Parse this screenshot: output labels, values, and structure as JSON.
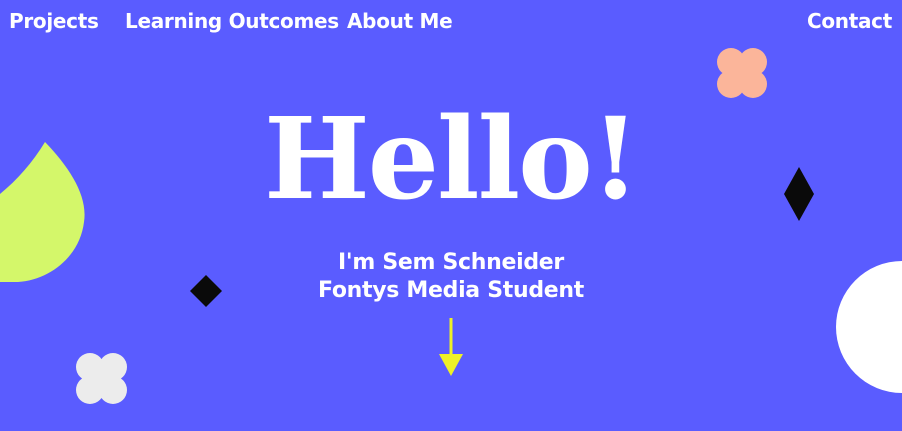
{
  "colors": {
    "background": "#5a5cff",
    "text": "#ffffff",
    "lime": "#d4f76a",
    "peach": "#fbb59a",
    "light_gray": "#ececec",
    "black": "#0a0a0a",
    "arrow_yellow": "#eef126"
  },
  "nav": {
    "projects_label": "Projects",
    "learning_outcomes_label": "Learning Outcomes",
    "about_me_label": "About Me",
    "contact_label": "Contact"
  },
  "hero": {
    "title": "Hello!",
    "line1": "I'm Sem Schneider",
    "line2": "Fontys Media Student"
  },
  "icons": {
    "scroll": "arrow-down-icon",
    "decor": [
      "lime-drop-shape",
      "peach-flower-shape",
      "gray-flower-shape",
      "black-diamond-shape",
      "white-circle-shape"
    ]
  }
}
